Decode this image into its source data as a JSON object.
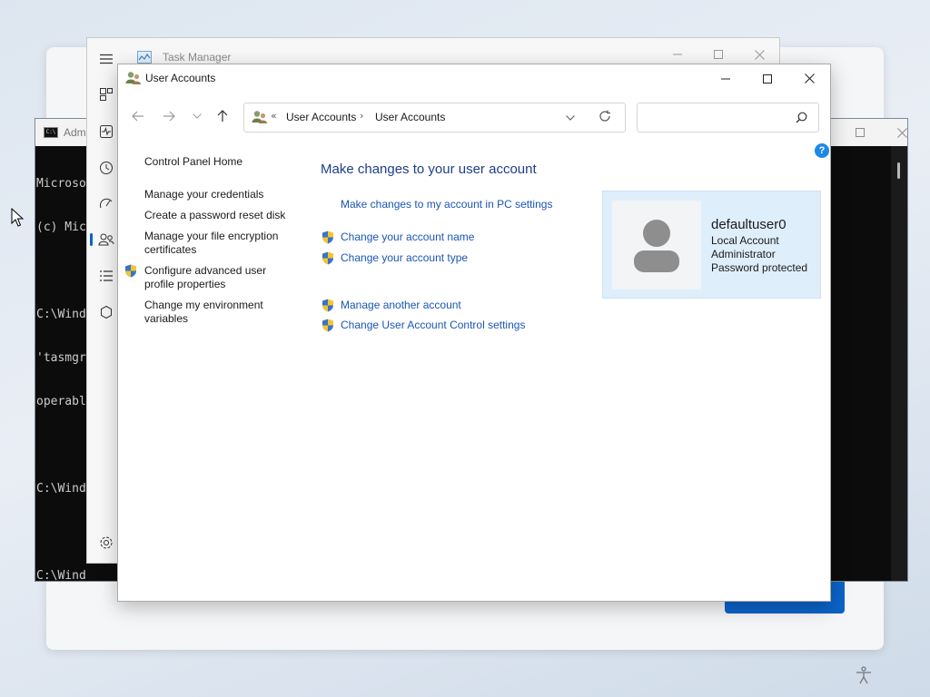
{
  "cmd": {
    "title": "Adm",
    "lines": [
      "Microso",
      "(c) Mic",
      "",
      "C:\\Wind",
      "'tasmgr",
      "operabl",
      "",
      "C:\\Wind",
      "",
      "C:\\Wind"
    ]
  },
  "taskmanager": {
    "title": "Task Manager",
    "nav_icons": [
      "hamburger-icon",
      "processes-icon",
      "performance-icon",
      "app-history-icon",
      "startup-apps-icon",
      "users-icon",
      "details-icon",
      "services-icon",
      "settings-icon"
    ]
  },
  "useraccounts": {
    "window_title": "User Accounts",
    "address": {
      "overflow": "«",
      "crumb1": "User Accounts",
      "separator": "›",
      "crumb2": "User Accounts"
    },
    "search": {
      "placeholder": "",
      "value": ""
    },
    "help": "?",
    "left_links": {
      "home": "Control Panel Home",
      "credentials": "Manage your credentials",
      "reset_disk": "Create a password reset disk",
      "encryption_1": "Manage your file encryption",
      "encryption_2": "certificates",
      "profile_1": "Configure advanced user",
      "profile_2": "profile properties",
      "env_1": "Change my environment",
      "env_2": "variables"
    },
    "main": {
      "title": "Make changes to your user account",
      "pc_settings": "Make changes to my account in PC settings",
      "account_name": "Change your account name",
      "account_type": "Change your account type",
      "another_account": "Manage another account",
      "uac_settings": "Change User Account Control settings"
    },
    "account": {
      "name": "defaultuser0",
      "type": "Local Account",
      "role": "Administrator",
      "password": "Password protected"
    }
  },
  "colors": {
    "link": "#1b55b5",
    "heading": "#1e3d8a",
    "accent": "#0a64c8",
    "card": "#dfeefb"
  }
}
